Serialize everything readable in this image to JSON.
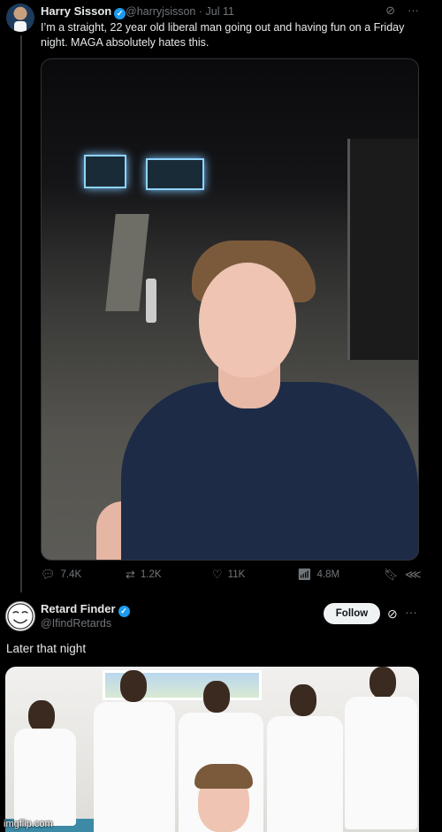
{
  "tweet1": {
    "author_name": "Harry Sisson",
    "handle": "@harryjsisson",
    "separator": "·",
    "date": "Jul 11",
    "text": "I’m a straight, 22 year old liberal man going out and having fun on a Friday night. MAGA absolutely hates this.",
    "icons": [
      "grok-icon",
      "more-icon"
    ],
    "stats": {
      "replies": "7.4K",
      "reposts": "1.2K",
      "likes": "11K",
      "views": "4.8M"
    }
  },
  "tweet2": {
    "author_name": "Retard Finder",
    "handle": "@IfindRetards",
    "follow_label": "Follow",
    "text": "Later that night"
  },
  "watermark": "imgflip.com",
  "colors": {
    "background": "#000000",
    "text": "#e7e9ea",
    "muted": "#71767b",
    "verified": "#1d9bf0",
    "follow_bg": "#eff3f4"
  }
}
